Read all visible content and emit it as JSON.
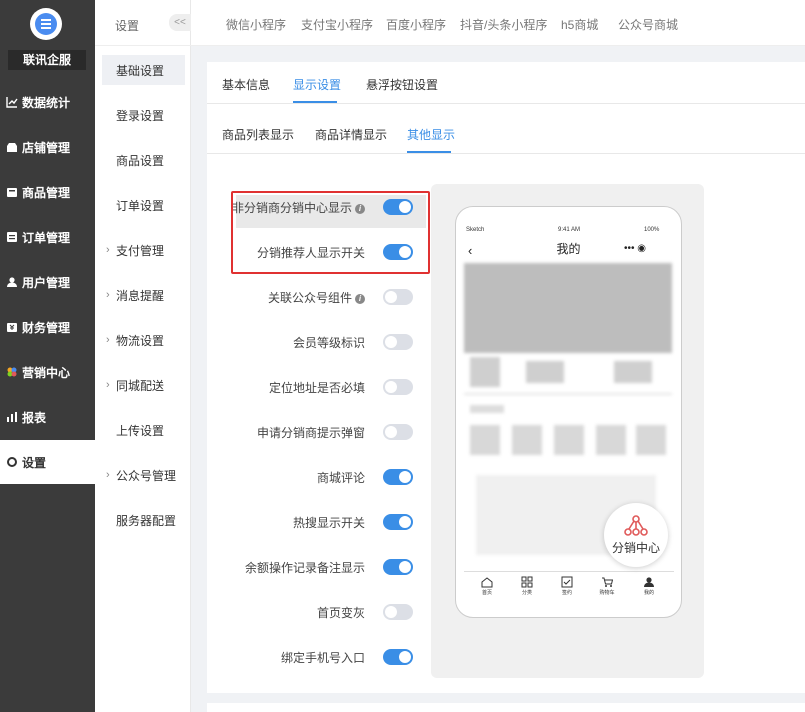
{
  "sidebar": {
    "company": "联讯企服",
    "items": [
      {
        "label": "数据统计",
        "icon": "chart-icon"
      },
      {
        "label": "店铺管理",
        "icon": "shop-icon"
      },
      {
        "label": "商品管理",
        "icon": "goods-icon"
      },
      {
        "label": "订单管理",
        "icon": "order-icon"
      },
      {
        "label": "用户管理",
        "icon": "user-icon"
      },
      {
        "label": "财务管理",
        "icon": "finance-icon"
      },
      {
        "label": "营销中心",
        "icon": "marketing-icon"
      },
      {
        "label": "报表",
        "icon": "report-icon"
      },
      {
        "label": "设置",
        "icon": "settings-icon",
        "active": true
      }
    ]
  },
  "subnav": {
    "title": "设置",
    "collapse": "<<",
    "items": [
      {
        "label": "基础设置",
        "active": true
      },
      {
        "label": "登录设置"
      },
      {
        "label": "商品设置"
      },
      {
        "label": "订单设置"
      },
      {
        "label": "支付管理",
        "expandable": true
      },
      {
        "label": "消息提醒",
        "expandable": true
      },
      {
        "label": "物流设置",
        "expandable": true
      },
      {
        "label": "同城配送",
        "expandable": true
      },
      {
        "label": "上传设置"
      },
      {
        "label": "公众号管理",
        "expandable": true
      },
      {
        "label": "服务器配置"
      }
    ]
  },
  "topbar": {
    "tabs": [
      "微信小程序",
      "支付宝小程序",
      "百度小程序",
      "抖音/头条小程序",
      "h5商城",
      "公众号商城"
    ]
  },
  "tabs_main": [
    "基本信息",
    "显示设置",
    "悬浮按钮设置"
  ],
  "tabs_main_active": "显示设置",
  "tabs_sub": [
    "商品列表显示",
    "商品详情显示",
    "其他显示"
  ],
  "tabs_sub_active": "其他显示",
  "settings": [
    {
      "label": "非分销商分销中心显示",
      "info": true,
      "on": true
    },
    {
      "label": "分销推荐人显示开关",
      "info": false,
      "on": true
    },
    {
      "label": "关联公众号组件",
      "info": true,
      "on": false
    },
    {
      "label": "会员等级标识",
      "info": false,
      "on": false
    },
    {
      "label": "定位地址是否必填",
      "info": false,
      "on": false
    },
    {
      "label": "申请分销商提示弹窗",
      "info": false,
      "on": false
    },
    {
      "label": "商城评论",
      "info": false,
      "on": true
    },
    {
      "label": "热搜显示开关",
      "info": false,
      "on": true
    },
    {
      "label": "余额操作记录备注显示",
      "info": false,
      "on": true
    },
    {
      "label": "首页变灰",
      "info": false,
      "on": false
    },
    {
      "label": "绑定手机号入口",
      "info": false,
      "on": true
    }
  ],
  "phone": {
    "carrier": "Sketch",
    "time": "9:41 AM",
    "battery": "100%",
    "title": "我的",
    "fab_label": "分销中心",
    "tabbar": [
      "首页",
      "分类",
      "签约",
      "购物车",
      "我的"
    ]
  },
  "colors": {
    "accent": "#3a8ee6",
    "highlight_border": "#e03131",
    "fab_icon": "#e05a5a"
  }
}
